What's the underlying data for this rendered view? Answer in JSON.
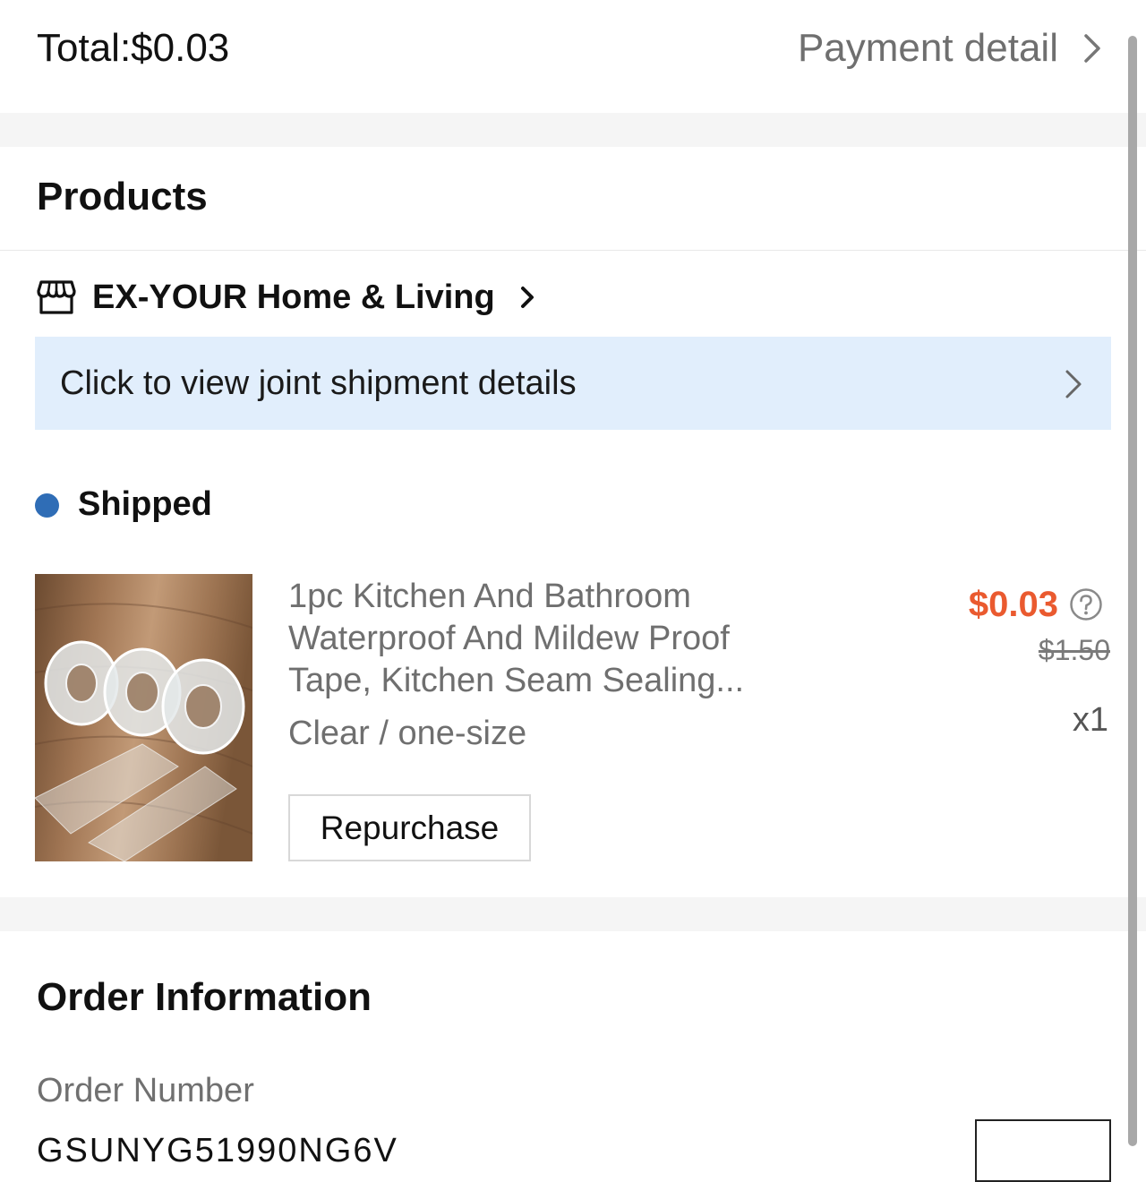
{
  "summary": {
    "total_text": "Total:$0.03",
    "payment_detail_label": "Payment detail"
  },
  "products_section": {
    "title": "Products",
    "store_name": "EX-YOUR Home & Living",
    "joint_shipment_text": "Click to view joint shipment details",
    "status": {
      "label": "Shipped",
      "color": "#2f6db6"
    },
    "item": {
      "title_lines": [
        "1pc Kitchen And Bathroom",
        "Waterproof And Mildew Proof",
        "Tape, Kitchen Seam Sealing..."
      ],
      "variant": "Clear / one-size",
      "price": "$0.03",
      "original_price": "$1.50",
      "quantity": "x1",
      "repurchase_label": "Repurchase",
      "price_color": "#ea5a2f"
    }
  },
  "order_information": {
    "title": "Order Information",
    "order_number_label": "Order Number",
    "order_number_value": "GSUNYG51990NG6V"
  },
  "icons": {
    "payment_chevron": "chevron-right-icon",
    "store": "store-icon",
    "price_help": "question-circle-icon"
  },
  "colors": {
    "banner_background": "#e1eefc",
    "section_gap": "#f5f5f5"
  }
}
